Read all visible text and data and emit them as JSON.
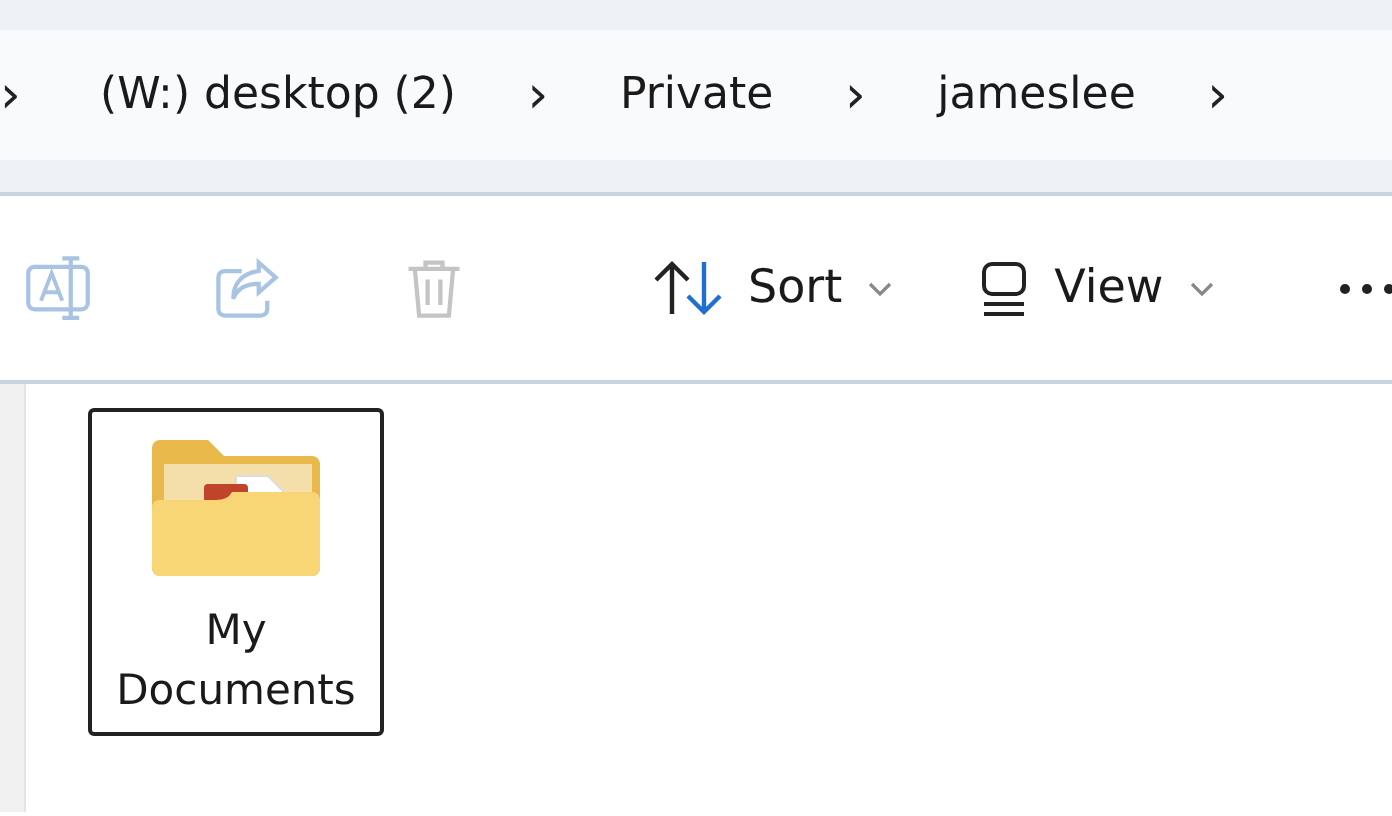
{
  "breadcrumb": {
    "separator": "›",
    "items": [
      "(W:) desktop (2)",
      "Private",
      "jameslee"
    ]
  },
  "toolbar": {
    "actions": [
      {
        "kind": "rename",
        "disabled": true
      },
      {
        "kind": "share",
        "disabled": true
      },
      {
        "kind": "delete",
        "disabled": true
      }
    ],
    "menus": [
      {
        "kind": "sort",
        "label": "Sort"
      },
      {
        "kind": "view",
        "label": "View"
      }
    ]
  },
  "files": [
    {
      "name": "My Documents",
      "selected": true
    }
  ]
}
